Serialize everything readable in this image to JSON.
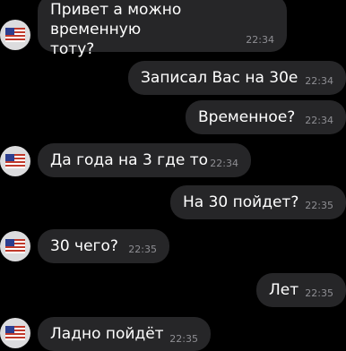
{
  "messages": [
    {
      "side": "in",
      "text": "Привет а можно временную тоту?",
      "line1": "Привет а можно временную",
      "line2": "тоту?",
      "time": "22:34"
    },
    {
      "side": "out",
      "text": "Записал Вас на 30е",
      "time": "22:34"
    },
    {
      "side": "out",
      "text": "Временное?",
      "time": "22:34"
    },
    {
      "side": "in",
      "text": "Да года на 3 где то",
      "time": "22:34"
    },
    {
      "side": "out",
      "text": "На 30 пойдет?",
      "time": "22:35"
    },
    {
      "side": "in",
      "text": "30 чего?",
      "time": "22:35"
    },
    {
      "side": "out",
      "text": "Лет",
      "time": "22:35"
    },
    {
      "side": "in",
      "text": "Ладно пойдёт",
      "time": "22:35"
    }
  ],
  "avatar": {
    "icon": "us-flag-avatar-icon"
  },
  "colors": {
    "background": "#000000",
    "bubble": "#262628",
    "text": "#ffffff",
    "time": "#8e8e93"
  }
}
